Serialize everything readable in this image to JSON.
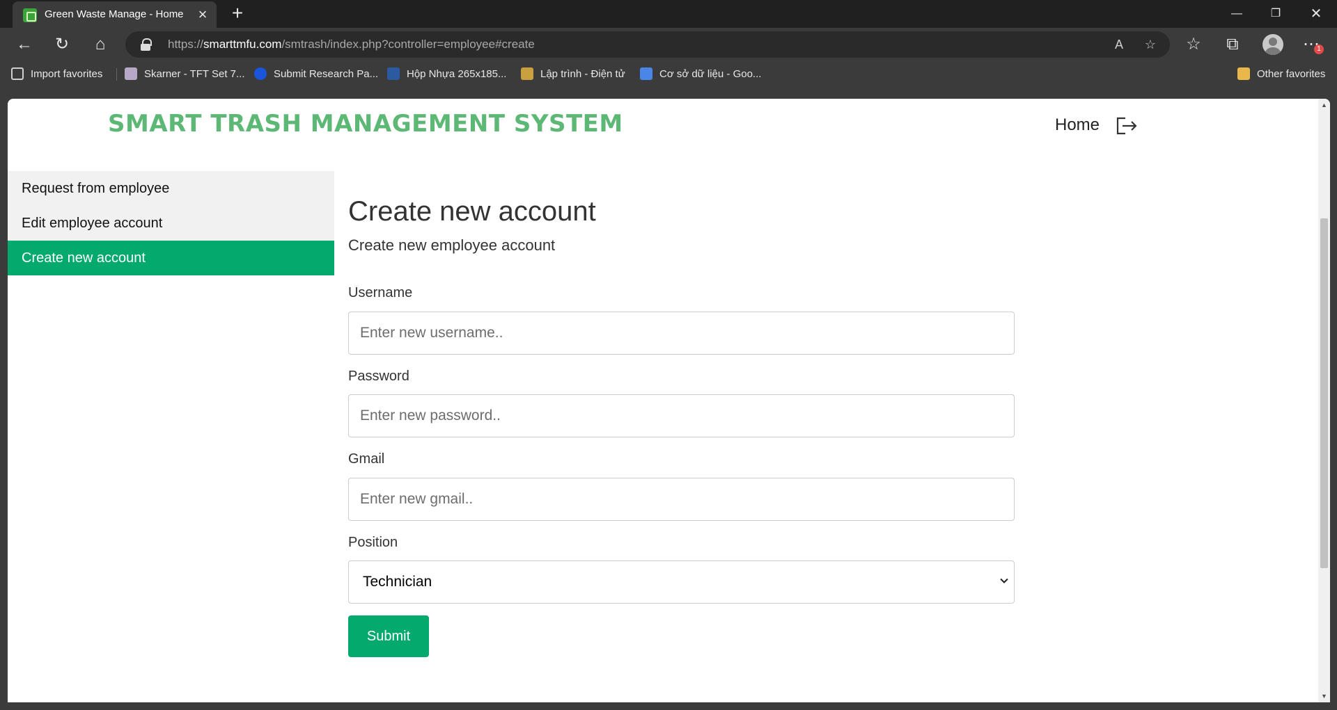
{
  "browser": {
    "tab": {
      "title": "Green Waste Manage - Home"
    },
    "address": {
      "prefix": "https://",
      "host": "smarttmfu.com",
      "path": "/smtrash/index.php?controller=employee#create"
    },
    "notification_count": "1",
    "favorites": [
      {
        "label": "Import favorites",
        "icon": "import-favorites-icon"
      },
      {
        "label": "Skarner - TFT Set 7...",
        "icon": "skarner-icon"
      },
      {
        "label": "Submit Research Pa...",
        "icon": "c-logo-icon"
      },
      {
        "label": "Hộp Nhựa 265x185...",
        "icon": "shop-icon"
      },
      {
        "label": "Lập trình - Điện tử",
        "icon": "robot-icon"
      },
      {
        "label": "Cơ sở dữ liệu - Goo...",
        "icon": "google-docs-icon"
      },
      {
        "label": "Other favorites",
        "icon": "folder-icon"
      }
    ]
  },
  "site": {
    "title": "SMART TRASH MANAGEMENT SYSTEM",
    "nav_home": "Home",
    "accent_color": "#5cb874",
    "primary_color": "#04aa6d"
  },
  "sidebar": {
    "items": [
      {
        "label": "Request from employee",
        "active": false
      },
      {
        "label": "Edit employee account",
        "active": false
      },
      {
        "label": "Create new account",
        "active": true
      }
    ]
  },
  "form": {
    "heading": "Create new account",
    "subheading": "Create new employee account",
    "username": {
      "label": "Username",
      "placeholder": "Enter new username.."
    },
    "password": {
      "label": "Password",
      "placeholder": "Enter new password.."
    },
    "gmail": {
      "label": "Gmail",
      "placeholder": "Enter new gmail.."
    },
    "position": {
      "label": "Position",
      "value": "Technician"
    },
    "submit_label": "Submit"
  }
}
